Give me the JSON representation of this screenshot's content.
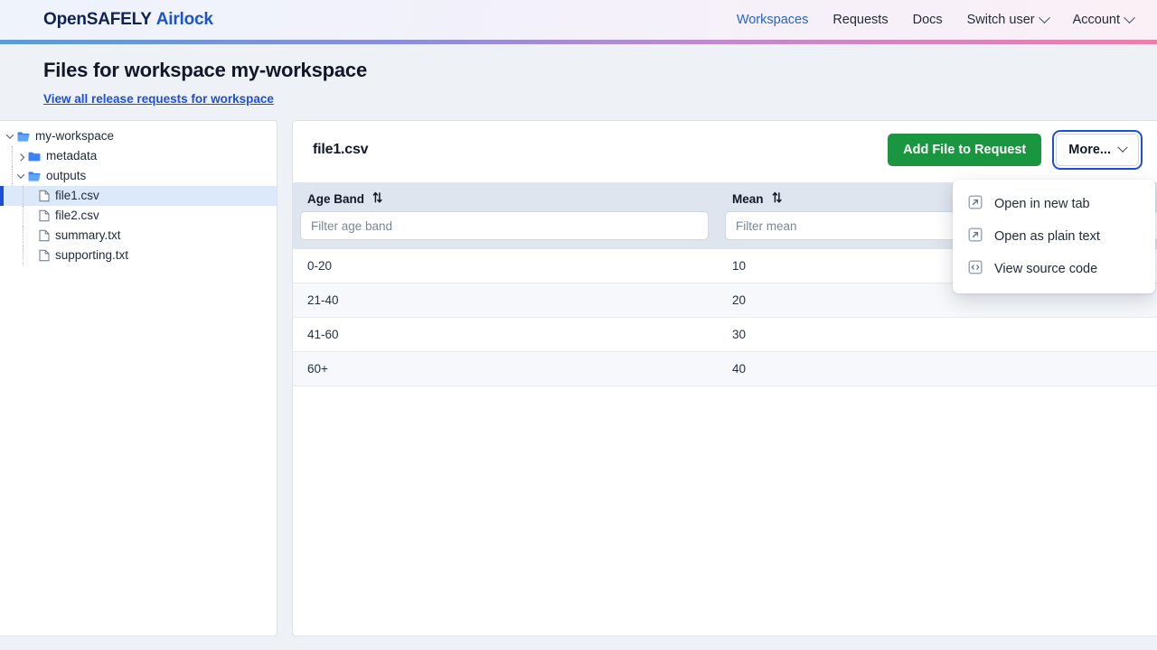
{
  "header": {
    "brand_open": "OpenSAFELY",
    "brand_product": "Airlock",
    "nav": [
      {
        "label": "Workspaces",
        "active": true,
        "caret": false
      },
      {
        "label": "Requests",
        "active": false,
        "caret": false
      },
      {
        "label": "Docs",
        "active": false,
        "caret": false
      },
      {
        "label": "Switch user",
        "active": false,
        "caret": true
      },
      {
        "label": "Account",
        "active": false,
        "caret": true
      }
    ]
  },
  "page": {
    "title": "Files for workspace my-workspace",
    "link": "View all release requests for workspace"
  },
  "sidebar": {
    "tree": [
      {
        "label": "my-workspace",
        "type": "folder-open",
        "depth": 0,
        "twisty": "open",
        "selected": false
      },
      {
        "label": "metadata",
        "type": "folder-closed",
        "depth": 1,
        "twisty": "closed",
        "selected": false
      },
      {
        "label": "outputs",
        "type": "folder-open",
        "depth": 1,
        "twisty": "open",
        "selected": false
      },
      {
        "label": "file1.csv",
        "type": "file",
        "depth": 2,
        "twisty": "none",
        "selected": true
      },
      {
        "label": "file2.csv",
        "type": "file",
        "depth": 2,
        "twisty": "none",
        "selected": false
      },
      {
        "label": "summary.txt",
        "type": "file",
        "depth": 2,
        "twisty": "none",
        "selected": false
      },
      {
        "label": "supporting.txt",
        "type": "file",
        "depth": 2,
        "twisty": "none",
        "selected": false
      }
    ]
  },
  "main": {
    "file_name": "file1.csv",
    "add_to_request_label": "Add File to Request",
    "more_label": "More...",
    "dropdown": {
      "open": true,
      "items": [
        {
          "label": "Open in new tab",
          "icon": "external-link-icon"
        },
        {
          "label": "Open as plain text",
          "icon": "external-link-icon"
        },
        {
          "label": "View source code",
          "icon": "code-brackets-icon"
        }
      ]
    },
    "table": {
      "columns": [
        {
          "header": "Age Band",
          "filter_placeholder": "Filter age band",
          "filter_value": "",
          "sortable": true
        },
        {
          "header": "Mean",
          "filter_placeholder": "Filter mean",
          "filter_value": "",
          "sortable": true
        },
        {
          "header": "",
          "filter_placeholder": "",
          "filter_value": "",
          "sortable": false
        }
      ],
      "rows": [
        {
          "age_band": "0-20",
          "mean": "10",
          "extra": ""
        },
        {
          "age_band": "21-40",
          "mean": "20",
          "extra": ""
        },
        {
          "age_band": "41-60",
          "mean": "30",
          "extra": ""
        },
        {
          "age_band": "60+",
          "mean": "40",
          "extra": ""
        }
      ]
    }
  },
  "colors": {
    "brand_navy": "#10224f",
    "brand_blue": "#1b56c9",
    "link_blue": "#1d4ed8",
    "primary_green": "#1a9641",
    "selection_blue": "#dbe9fb",
    "page_bg": "#eef1f6",
    "table_header_bg": "#dee5ef"
  }
}
